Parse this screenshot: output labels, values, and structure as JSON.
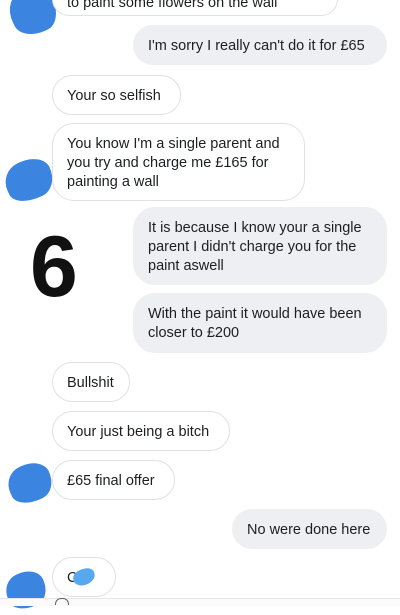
{
  "conversation": {
    "messages": [
      {
        "sender": "them",
        "text": "to paint some flowers on the wall"
      },
      {
        "sender": "me",
        "text": "I'm sorry I really can't do it for £65"
      },
      {
        "sender": "them",
        "text": "Your so selfish"
      },
      {
        "sender": "them",
        "text": "You know I'm a single parent and you try and charge me £165 for painting a wall"
      },
      {
        "sender": "me",
        "text": "It is because I know your a single parent I didn't charge you for the paint aswell"
      },
      {
        "sender": "me",
        "text": "With the paint it would have been closer to £200"
      },
      {
        "sender": "them",
        "text": "Bullshit"
      },
      {
        "sender": "them",
        "text": "Your just being a bitch"
      },
      {
        "sender": "them",
        "text": "£65 final offer"
      },
      {
        "sender": "me",
        "text": "No were done here"
      },
      {
        "sender": "them",
        "text": "C  t!"
      }
    ]
  },
  "overlay": {
    "number": "6"
  },
  "colors": {
    "incoming_bg": "#ffffff",
    "outgoing_bg": "#eeeff2",
    "avatar_blob": "#3b84e0",
    "censor_blob": "#58a8ef"
  }
}
